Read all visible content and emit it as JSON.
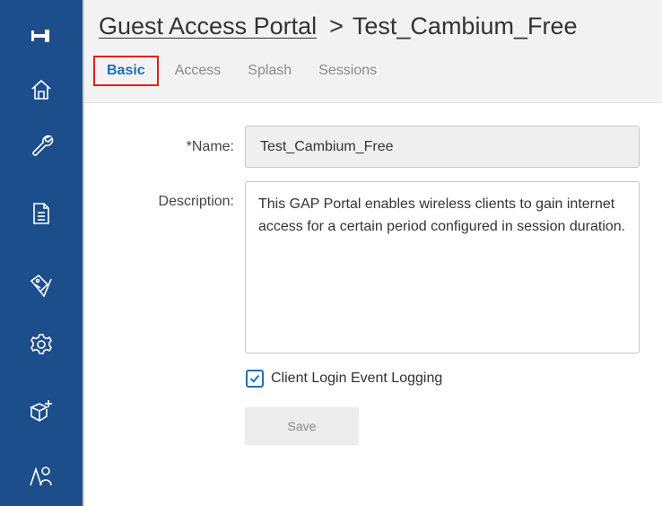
{
  "sidebar": {
    "background": "#1d4e8c",
    "items": [
      {
        "icon": "pin-icon"
      },
      {
        "icon": "home-icon"
      },
      {
        "icon": "wrench-icon"
      },
      {
        "icon": "document-icon"
      },
      {
        "icon": "tag-tool-icon"
      },
      {
        "icon": "gear-icon"
      },
      {
        "icon": "add-box-icon"
      },
      {
        "icon": "users-icon"
      }
    ]
  },
  "breadcrumb": {
    "parent": "Guest Access Portal",
    "separator": ">",
    "current": "Test_Cambium_Free"
  },
  "tabs": [
    {
      "label": "Basic",
      "active": true
    },
    {
      "label": "Access",
      "active": false
    },
    {
      "label": "Splash",
      "active": false
    },
    {
      "label": "Sessions",
      "active": false
    }
  ],
  "form": {
    "name_label": "*Name:",
    "name_value": "Test_Cambium_Free",
    "description_label": "Description:",
    "description_value": "This GAP Portal enables wireless clients to gain internet access for a certain period configured in session duration.",
    "logging_label": "Client Login Event Logging",
    "logging_checked": true,
    "save_label": "Save"
  },
  "colors": {
    "accent": "#1f6fb4",
    "active_tab_outline": "#e02020"
  }
}
